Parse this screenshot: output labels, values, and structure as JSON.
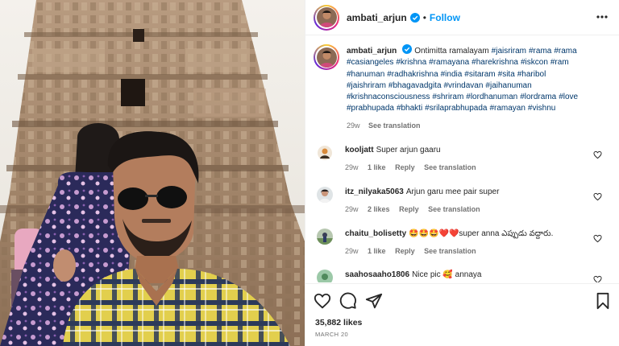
{
  "post": {
    "author": "ambati_arjun",
    "follow_label": "Follow",
    "separator": "•",
    "caption_lines": [
      [
        {
          "t": "Ontimitta ramalayam "
        },
        {
          "h": "#jaisriram"
        },
        {
          "t": " "
        },
        {
          "h": "#rama"
        },
        {
          "t": " "
        },
        {
          "h": "#rama"
        }
      ],
      [
        {
          "h": "#casiangeles"
        },
        {
          "t": " "
        },
        {
          "h": "#krishna"
        },
        {
          "t": " "
        },
        {
          "h": "#ramayana"
        },
        {
          "t": " "
        },
        {
          "h": "#harekrishna"
        },
        {
          "t": " "
        },
        {
          "h": "#iskcon"
        },
        {
          "t": " "
        },
        {
          "h": "#ram"
        }
      ],
      [
        {
          "h": "#hanuman"
        },
        {
          "t": " "
        },
        {
          "h": "#radhakrishna"
        },
        {
          "t": " "
        },
        {
          "h": "#india"
        },
        {
          "t": " "
        },
        {
          "h": "#sitaram"
        },
        {
          "t": " "
        },
        {
          "h": "#sita"
        },
        {
          "t": " "
        },
        {
          "h": "#haribol"
        }
      ],
      [
        {
          "h": "#jaishriram"
        },
        {
          "t": " "
        },
        {
          "h": "#bhagavadgita"
        },
        {
          "t": " "
        },
        {
          "h": "#vrindavan"
        },
        {
          "t": " "
        },
        {
          "h": "#jaihanuman"
        }
      ],
      [
        {
          "h": "#krishnaconsciousness"
        },
        {
          "t": " "
        },
        {
          "h": "#shriram"
        },
        {
          "t": " "
        },
        {
          "h": "#lordhanuman"
        },
        {
          "t": " "
        },
        {
          "h": "#lordrama"
        },
        {
          "t": " "
        },
        {
          "h": "#love"
        }
      ],
      [
        {
          "h": "#prabhupada"
        },
        {
          "t": " "
        },
        {
          "h": "#bhakti"
        },
        {
          "t": " "
        },
        {
          "h": "#srilaprabhupada"
        },
        {
          "t": " "
        },
        {
          "h": "#ramayan"
        },
        {
          "t": " "
        },
        {
          "h": "#vishnu"
        }
      ]
    ],
    "caption_age": "29w",
    "see_translation": "See translation",
    "likes": "35,882 likes",
    "date": "MARCH 20"
  },
  "comments": [
    {
      "user": "kooljatt",
      "text": "Super arjun gaaru",
      "age": "29w",
      "likes": "1 like",
      "reply": "Reply",
      "translate": "See translation"
    },
    {
      "user": "itz_nilyaka5063",
      "text": "Arjun garu mee pair super",
      "age": "29w",
      "likes": "2 likes",
      "reply": "Reply",
      "translate": "See translation"
    },
    {
      "user": "chaitu_bolisetty",
      "emoji": "🤩🤩🤩❤️❤️",
      "text": "super anna ఎప్పుడు వద్దారు.",
      "age": "29w",
      "likes": "1 like",
      "reply": "Reply",
      "translate": "See translation"
    },
    {
      "user": "saahosaaho1806",
      "text": "Nice pic 🥰 annaya"
    }
  ],
  "icons": {
    "verified": "verified-badge-icon",
    "more": "more-options-icon",
    "heart": "heart-icon",
    "comment": "comment-icon",
    "share": "share-icon",
    "save": "bookmark-icon"
  },
  "colors": {
    "accent": "#0095f6",
    "hashtag": "#00376b",
    "muted": "#737373"
  }
}
